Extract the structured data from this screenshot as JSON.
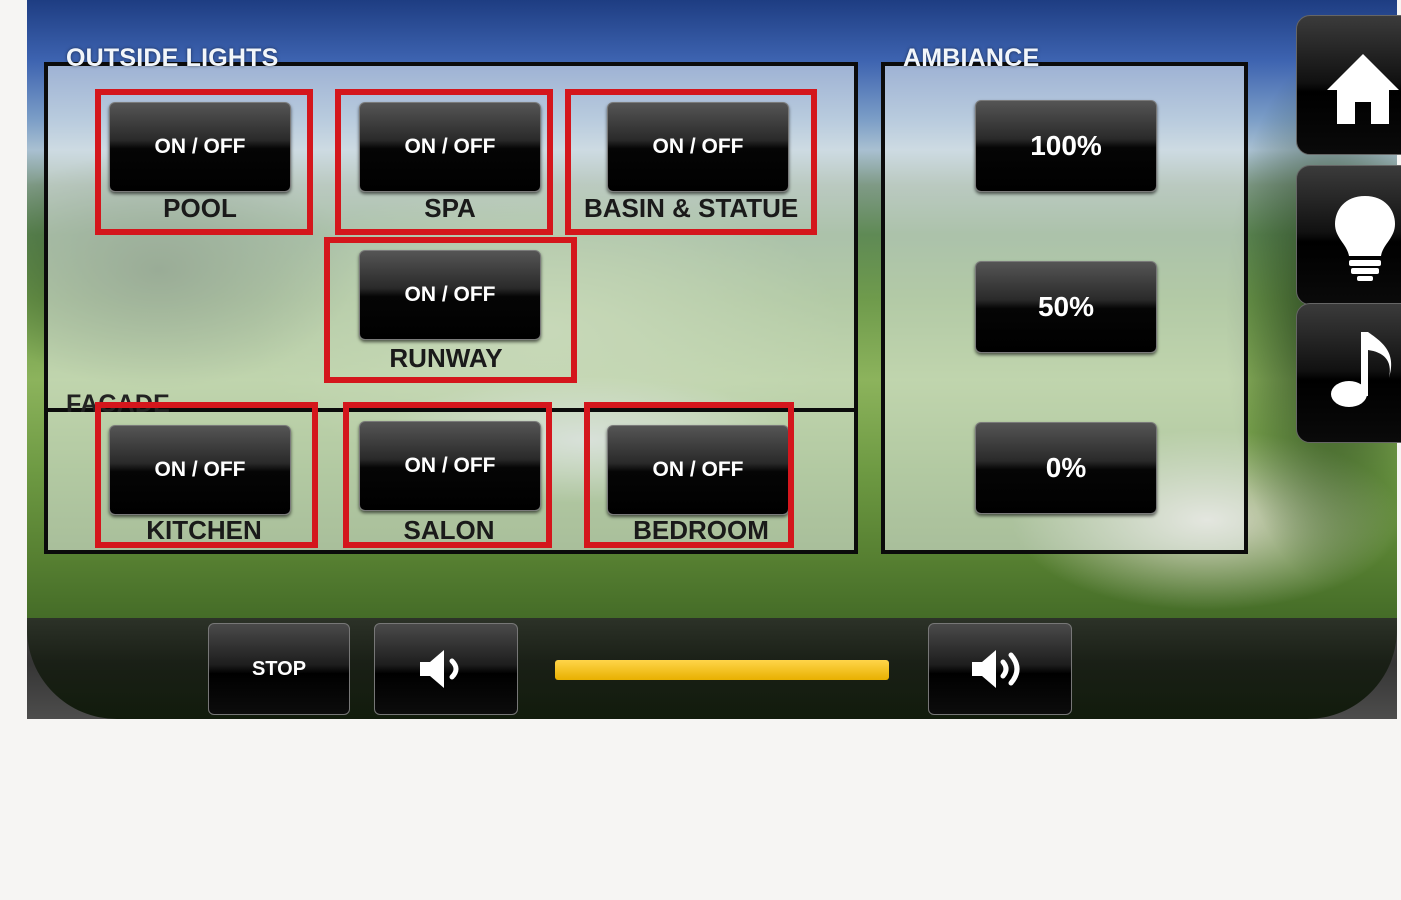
{
  "outside_lights": {
    "title": "OUTSIDE LIGHTS",
    "controls": [
      {
        "button": "ON / OFF",
        "label": "POOL"
      },
      {
        "button": "ON / OFF",
        "label": "SPA"
      },
      {
        "button": "ON / OFF",
        "label": "BASIN & STATUE"
      },
      {
        "button": "ON / OFF",
        "label": "RUNWAY"
      }
    ]
  },
  "facade": {
    "title": "FACADE",
    "controls": [
      {
        "button": "ON / OFF",
        "label": "KITCHEN"
      },
      {
        "button": "ON / OFF",
        "label": "SALON"
      },
      {
        "button": "ON / OFF",
        "label": "BEDROOM"
      }
    ]
  },
  "ambiance": {
    "title": "AMBIANCE",
    "presets": [
      "100%",
      "50%",
      "0%"
    ]
  },
  "sidebar": {
    "items": [
      {
        "icon": "home-icon"
      },
      {
        "icon": "lightbulb-icon"
      },
      {
        "icon": "music-note-icon"
      }
    ]
  },
  "player": {
    "stop_label": "STOP",
    "volume_level": 1.0,
    "volume_down_icon": "speaker-low-icon",
    "volume_up_icon": "speaker-high-icon"
  },
  "colors": {
    "highlight": "#d4161c",
    "volume_bar": "#f0c020"
  }
}
